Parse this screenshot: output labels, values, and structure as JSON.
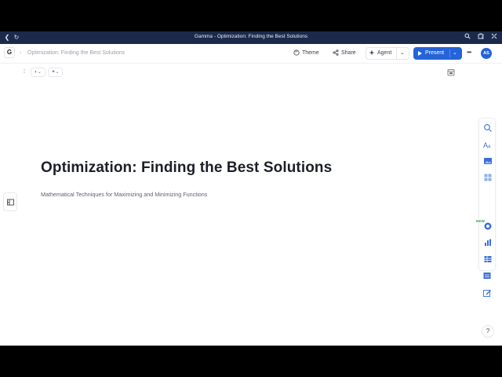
{
  "window": {
    "title": "Gamma - Optimization: Finding the Best Solutions"
  },
  "topbar": {
    "logo": "G",
    "breadcrumb": "Optimization: Finding the Best Solutions",
    "theme_label": "Theme",
    "share_label": "Share",
    "agent_label": "Agent",
    "present_label": "Present",
    "avatar_initials": "AS"
  },
  "card": {
    "title": "Optimization: Finding the Best Solutions",
    "subtitle": "Mathematical Techniques for Maximizing and Minimizing Functions"
  },
  "toolbar": {
    "new_badge": "NEW"
  },
  "help_label": "?",
  "colors": {
    "titlebar": "#1b2a4a",
    "accent": "#2563d9",
    "new_badge": "#2a9d4a"
  }
}
